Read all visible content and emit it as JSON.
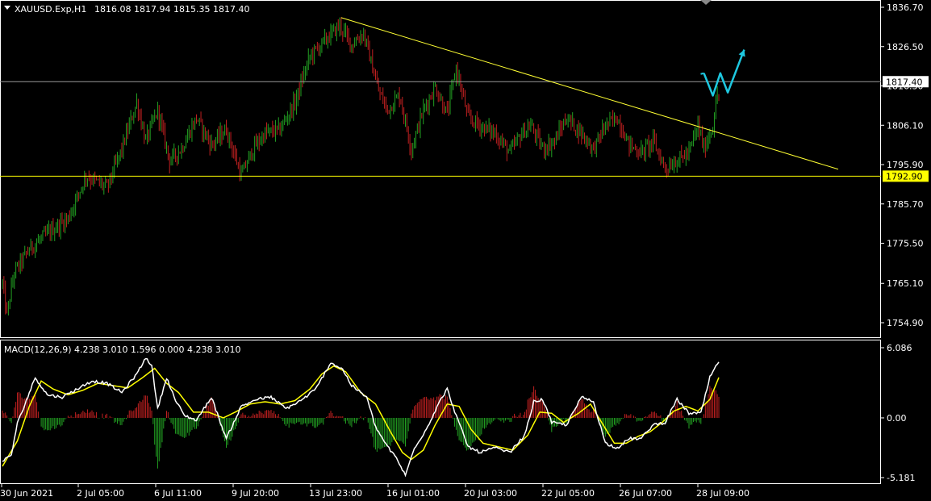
{
  "header": {
    "symbol": "XAUUSD.Exp,H1",
    "ohlc": "1816.08 1817.94 1815.35 1817.40"
  },
  "indicator": {
    "label": "MACD(12,26,9) 4.238 3.010 1.596 0.000 4.238 3.010"
  },
  "colors": {
    "background": "#000000",
    "bull": "#22a022",
    "bear": "#c02020",
    "frame": "#ffffff",
    "trendline": "#ffff33",
    "support": "#ffff00",
    "price_line": "#9a9a9a",
    "arrow": "#1ec8e0",
    "macd_line": "#ffffff",
    "signal_line": "#ffff00"
  },
  "chart_data": [
    {
      "type": "candlestick",
      "y_ticks": [
        1836.7,
        1826.5,
        1816.3,
        1806.1,
        1795.9,
        1785.7,
        1775.5,
        1765.1,
        1754.9
      ],
      "y_tick_labels": [
        "1836.70",
        "1826.50",
        "1816.30",
        "1806.10",
        "1795.90",
        "1785.70",
        "1775.50",
        "1765.10",
        "1754.90"
      ],
      "ylim": [
        1752.2,
        1838.3
      ],
      "x_tick_labels": [
        "30 Jun 2021",
        "2 Jul 05:00",
        "6 Jul 11:00",
        "9 Jul 20:00",
        "13 Jul 23:00",
        "16 Jul 01:00",
        "20 Jul 03:00",
        "22 Jul 05:00",
        "26 Jul 07:00",
        "28 Jul 09:00"
      ],
      "price_waypoints": [
        [
          0,
          1765
        ],
        [
          3,
          1757
        ],
        [
          8,
          1768
        ],
        [
          18,
          1774
        ],
        [
          30,
          1778
        ],
        [
          44,
          1782
        ],
        [
          56,
          1793
        ],
        [
          70,
          1790
        ],
        [
          80,
          1800
        ],
        [
          90,
          1812
        ],
        [
          96,
          1802
        ],
        [
          104,
          1810
        ],
        [
          112,
          1797
        ],
        [
          120,
          1800
        ],
        [
          130,
          1808
        ],
        [
          140,
          1801
        ],
        [
          150,
          1805
        ],
        [
          160,
          1793
        ],
        [
          168,
          1800
        ],
        [
          176,
          1804
        ],
        [
          186,
          1805
        ],
        [
          196,
          1812
        ],
        [
          206,
          1824
        ],
        [
          216,
          1828
        ],
        [
          226,
          1832
        ],
        [
          234,
          1827
        ],
        [
          242,
          1830
        ],
        [
          252,
          1815
        ],
        [
          258,
          1810
        ],
        [
          266,
          1814
        ],
        [
          274,
          1800
        ],
        [
          282,
          1810
        ],
        [
          290,
          1816
        ],
        [
          298,
          1809
        ],
        [
          304,
          1821
        ],
        [
          312,
          1808
        ],
        [
          320,
          1806
        ],
        [
          330,
          1804
        ],
        [
          340,
          1799
        ],
        [
          348,
          1804
        ],
        [
          354,
          1806
        ],
        [
          362,
          1800
        ],
        [
          370,
          1802
        ],
        [
          378,
          1808
        ],
        [
          388,
          1804
        ],
        [
          396,
          1800
        ],
        [
          404,
          1806
        ],
        [
          412,
          1808
        ],
        [
          420,
          1801
        ],
        [
          428,
          1799
        ],
        [
          436,
          1802
        ],
        [
          444,
          1795
        ],
        [
          452,
          1797
        ],
        [
          460,
          1799
        ],
        [
          466,
          1806
        ],
        [
          470,
          1800
        ],
        [
          476,
          1806
        ],
        [
          479,
          1814
        ]
      ],
      "support_level": 1792.9,
      "support_label": "1792.90",
      "last_price": 1817.4,
      "last_price_label": "1817.40",
      "trendline": [
        [
          227,
          1834.0
        ],
        [
          560,
          1794.7
        ]
      ],
      "forecast_path": [
        [
          470,
          1819.6
        ],
        [
          476,
          1813.8
        ],
        [
          481,
          1819.6
        ],
        [
          486,
          1814.6
        ],
        [
          497,
          1825.7
        ]
      ]
    },
    {
      "type": "macd",
      "name": "MACD(12,26,9)",
      "y_ticks": [
        6.086,
        0.0,
        -5.181
      ],
      "y_tick_labels": [
        "6.086",
        "0.00",
        "-5.181"
      ],
      "ylim": [
        -5.2,
        6.2
      ],
      "macd_waypoints": [
        [
          0,
          -3.8
        ],
        [
          6,
          -3.2
        ],
        [
          10,
          -0.5
        ],
        [
          16,
          1.5
        ],
        [
          22,
          3.5
        ],
        [
          30,
          2.0
        ],
        [
          40,
          1.8
        ],
        [
          50,
          2.5
        ],
        [
          60,
          3.2
        ],
        [
          70,
          3.0
        ],
        [
          80,
          2.2
        ],
        [
          90,
          3.8
        ],
        [
          96,
          5.2
        ],
        [
          100,
          4.6
        ],
        [
          104,
          0.8
        ],
        [
          110,
          3.5
        ],
        [
          116,
          1.5
        ],
        [
          122,
          0.2
        ],
        [
          130,
          -0.2
        ],
        [
          140,
          1.8
        ],
        [
          150,
          -1.8
        ],
        [
          160,
          1.0
        ],
        [
          170,
          1.6
        ],
        [
          180,
          1.8
        ],
        [
          190,
          0.8
        ],
        [
          200,
          1.5
        ],
        [
          210,
          2.5
        ],
        [
          220,
          4.8
        ],
        [
          228,
          4.2
        ],
        [
          234,
          2.8
        ],
        [
          244,
          1.8
        ],
        [
          250,
          -0.8
        ],
        [
          258,
          -2.5
        ],
        [
          264,
          -3.5
        ],
        [
          270,
          -5.0
        ],
        [
          276,
          -2.6
        ],
        [
          284,
          -1.0
        ],
        [
          292,
          1.2
        ],
        [
          298,
          2.5
        ],
        [
          304,
          0.2
        ],
        [
          312,
          -2.5
        ],
        [
          320,
          -3.0
        ],
        [
          330,
          -2.6
        ],
        [
          340,
          -3.0
        ],
        [
          350,
          -1.5
        ],
        [
          356,
          1.4
        ],
        [
          362,
          1.6
        ],
        [
          368,
          -0.4
        ],
        [
          378,
          -0.6
        ],
        [
          388,
          1.8
        ],
        [
          396,
          1.4
        ],
        [
          404,
          -2.2
        ],
        [
          412,
          -2.6
        ],
        [
          420,
          -1.8
        ],
        [
          428,
          -1.8
        ],
        [
          436,
          -0.6
        ],
        [
          444,
          -0.4
        ],
        [
          452,
          1.6
        ],
        [
          460,
          0.4
        ],
        [
          468,
          0.4
        ],
        [
          474,
          3.5
        ],
        [
          480,
          4.9
        ]
      ],
      "signal_waypoints": [
        [
          0,
          -4.2
        ],
        [
          10,
          -2.0
        ],
        [
          18,
          1.0
        ],
        [
          26,
          3.2
        ],
        [
          34,
          2.5
        ],
        [
          44,
          2.0
        ],
        [
          54,
          2.4
        ],
        [
          64,
          3.0
        ],
        [
          74,
          2.8
        ],
        [
          84,
          2.6
        ],
        [
          94,
          3.5
        ],
        [
          102,
          4.3
        ],
        [
          110,
          3.0
        ],
        [
          118,
          2.2
        ],
        [
          128,
          0.5
        ],
        [
          138,
          0.5
        ],
        [
          148,
          0.0
        ],
        [
          156,
          0.5
        ],
        [
          166,
          1.2
        ],
        [
          176,
          1.4
        ],
        [
          186,
          1.2
        ],
        [
          196,
          1.5
        ],
        [
          206,
          2.5
        ],
        [
          214,
          3.8
        ],
        [
          222,
          4.5
        ],
        [
          230,
          4.0
        ],
        [
          240,
          2.2
        ],
        [
          250,
          1.2
        ],
        [
          260,
          -1.2
        ],
        [
          268,
          -3.0
        ],
        [
          274,
          -3.6
        ],
        [
          282,
          -2.8
        ],
        [
          290,
          -0.6
        ],
        [
          298,
          1.2
        ],
        [
          306,
          1.0
        ],
        [
          314,
          -1.0
        ],
        [
          322,
          -2.2
        ],
        [
          332,
          -2.5
        ],
        [
          342,
          -2.8
        ],
        [
          352,
          -1.5
        ],
        [
          360,
          0.5
        ],
        [
          368,
          0.4
        ],
        [
          376,
          -0.4
        ],
        [
          386,
          0.4
        ],
        [
          394,
          1.2
        ],
        [
          402,
          -0.5
        ],
        [
          410,
          -2.2
        ],
        [
          418,
          -2.2
        ],
        [
          426,
          -1.6
        ],
        [
          434,
          -1.2
        ],
        [
          442,
          -0.4
        ],
        [
          450,
          0.6
        ],
        [
          458,
          1.0
        ],
        [
          466,
          0.6
        ],
        [
          474,
          1.6
        ],
        [
          480,
          3.5
        ]
      ]
    }
  ]
}
